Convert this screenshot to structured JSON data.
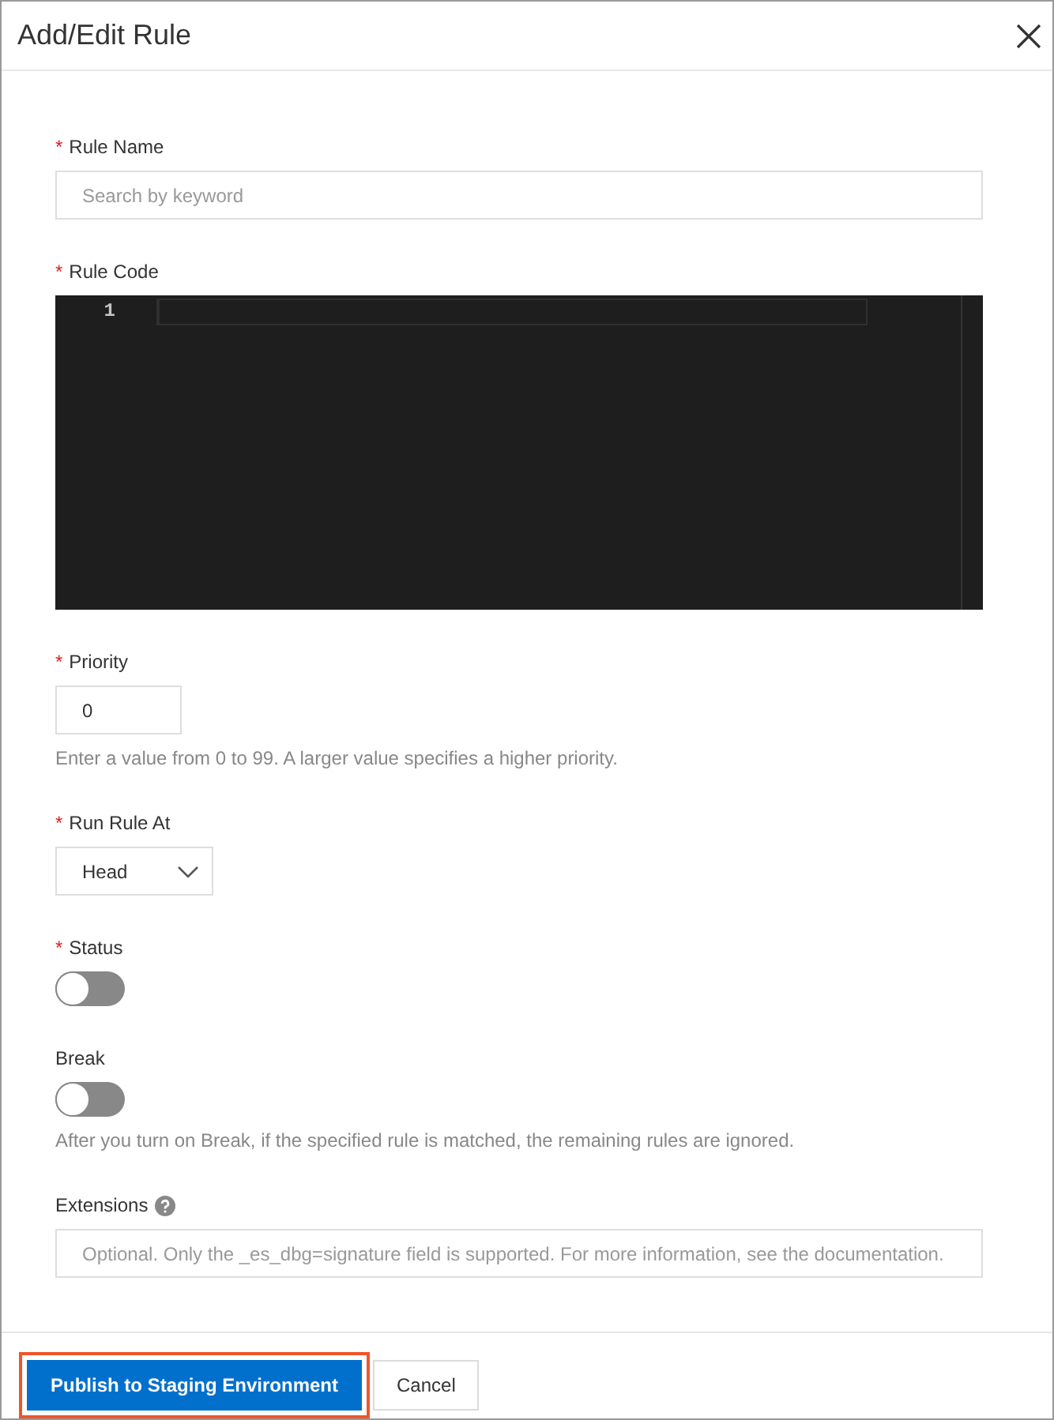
{
  "dialog": {
    "title": "Add/Edit Rule"
  },
  "fields": [
    {
      "kind": "text",
      "label": "Rule Name",
      "required_mark": "*",
      "placeholder": "Search by keyword"
    },
    {
      "kind": "code",
      "label": "Rule Code",
      "required_mark": "*",
      "line_numbers": [
        "1"
      ]
    },
    {
      "kind": "number",
      "label": "Priority",
      "required_mark": "*",
      "value": "0",
      "help": "Enter a value from 0 to 99. A larger value specifies a higher priority."
    },
    {
      "kind": "select",
      "label": "Run Rule At",
      "required_mark": "*",
      "value": "Head"
    },
    {
      "kind": "switch",
      "label": "Status",
      "required_mark": "*",
      "on": false
    },
    {
      "kind": "switch",
      "label": "Break",
      "on": false,
      "help": "After you turn on Break, if the specified rule is matched, the remaining rules are ignored."
    },
    {
      "kind": "text",
      "label": "Extensions",
      "help_icon": true,
      "placeholder": "Optional. Only the _es_dbg=signature field is supported. For more information, see the documentation."
    }
  ],
  "buttons": [
    {
      "label": "Publish to Staging Environment",
      "primary": true,
      "highlighted": true
    },
    {
      "label": "Cancel",
      "primary": false,
      "highlighted": false
    }
  ]
}
